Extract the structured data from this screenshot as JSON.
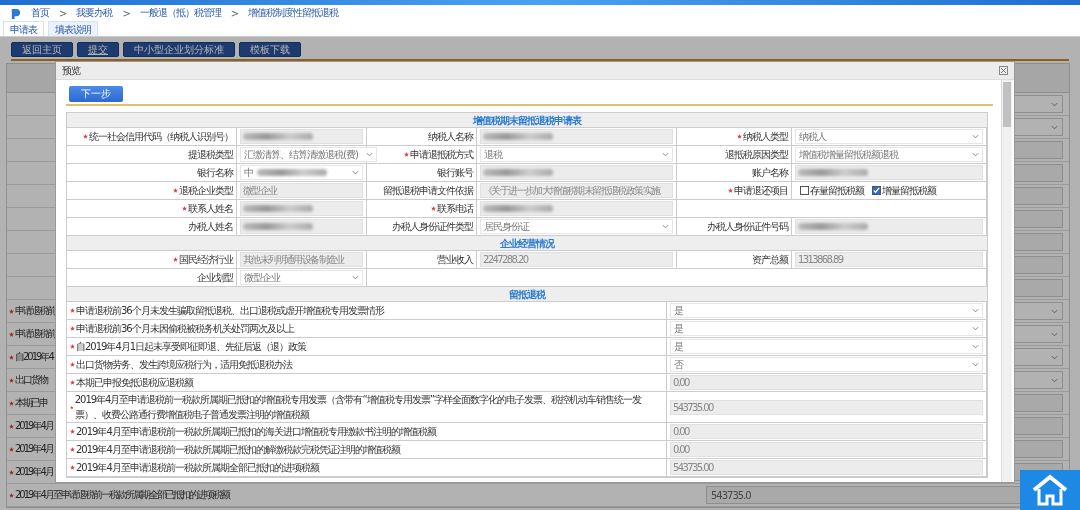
{
  "breadcrumb": {
    "separator": ">",
    "items": [
      "首页",
      "我要办税",
      "一般退（抵）税管理",
      "增值税制度性留抵退税"
    ]
  },
  "tabs": [
    {
      "label": "申请表",
      "selected": true
    },
    {
      "label": "填表说明",
      "selected": false
    }
  ],
  "toolbar": [
    {
      "label": "返回主页",
      "underlined": false
    },
    {
      "label": "提交",
      "underlined": true
    },
    {
      "label": "中小型企业划分标准",
      "underlined": false
    },
    {
      "label": "模板下载",
      "underlined": false
    }
  ],
  "background": {
    "rows": [
      {
        "kind": "select"
      },
      {
        "kind": "select"
      },
      {
        "kind": "input"
      },
      {
        "kind": "input"
      },
      {
        "kind": "input"
      },
      {
        "kind": "input"
      },
      {
        "kind": "input"
      },
      {
        "kind": "input"
      },
      {
        "kind": "input"
      },
      {
        "label": "申请退税前",
        "required": true,
        "kind": "select"
      },
      {
        "label": "申请退税前",
        "required": true,
        "kind": "select"
      },
      {
        "label": "自2019年4",
        "required": true,
        "kind": "select"
      },
      {
        "label": "出口货物",
        "required": true,
        "kind": "select"
      },
      {
        "label": "本期已申",
        "required": true,
        "kind": "input"
      },
      {
        "label": "2019年4月",
        "required": true,
        "kind": "input"
      },
      {
        "label": "2019年4月",
        "required": true,
        "kind": "input"
      },
      {
        "label": "2019年4月",
        "required": true,
        "kind": "input"
      },
      {
        "label": "2019年4月至申请退税前一税款所属期全部已抵扣的进项税额",
        "required": true,
        "kind": "input",
        "value": "543735.0"
      }
    ]
  },
  "dialog": {
    "title": "预览",
    "next_button": "下一步",
    "sections": [
      {
        "title": "增值税期末留抵退税申请表",
        "kind": "grid",
        "rows": [
          [
            {
              "label": "统一社会信用代码（纳税人识别号）",
              "required": true,
              "kind": "text",
              "redacted": true
            },
            {
              "label": "纳税人名称",
              "required": false,
              "kind": "text",
              "redacted": true
            },
            {
              "label": "纳税人类型",
              "required": true,
              "kind": "select",
              "value": "纳税人"
            }
          ],
          [
            {
              "label": "提退税类型",
              "required": false,
              "kind": "select",
              "value": "汇缴清算、结算清缴退税(费)"
            },
            {
              "label": "申请退抵税方式",
              "required": true,
              "kind": "select",
              "value": "退税"
            },
            {
              "label": "退抵税原因类型",
              "required": false,
              "kind": "select",
              "value": "增值税增量留抵税额退税"
            }
          ],
          [
            {
              "label": "银行名称",
              "required": false,
              "kind": "select",
              "value": "中",
              "redacted": true
            },
            {
              "label": "银行账号",
              "required": false,
              "kind": "text",
              "redacted": true
            },
            {
              "label": "账户名称",
              "required": false,
              "kind": "text",
              "redacted": true
            }
          ],
          [
            {
              "label": "退税企业类型",
              "required": true,
              "kind": "text",
              "value": "微型企业"
            },
            {
              "label": "留抵退税申请文件依据",
              "required": false,
              "kind": "text",
              "value": "《关于进一步加大增值税期末留抵退税政策实施"
            },
            {
              "label": "申请退还项目",
              "required": true,
              "kind": "checks",
              "options": [
                {
                  "label": "存量留抵税额",
                  "checked": false
                },
                {
                  "label": "增量留抵税额",
                  "checked": true
                }
              ]
            }
          ],
          [
            {
              "label": "联系人姓名",
              "required": true,
              "kind": "text",
              "redacted": true
            },
            {
              "label": "联系电话",
              "required": true,
              "kind": "text",
              "redacted": true
            },
            {
              "kind": "blank"
            }
          ],
          [
            {
              "label": "办税人姓名",
              "required": false,
              "kind": "text",
              "redacted": true
            },
            {
              "label": "办税人身份证件类型",
              "required": false,
              "kind": "select",
              "value": "居民身份证"
            },
            {
              "label": "办税人身份证件号码",
              "required": false,
              "kind": "text",
              "redacted": true
            }
          ]
        ]
      },
      {
        "title": "企业经营情况",
        "kind": "grid",
        "rows": [
          [
            {
              "label": "国民经济行业",
              "required": true,
              "kind": "text",
              "value": "其他未列明通用设备制造业"
            },
            {
              "label": "营业收入",
              "required": false,
              "kind": "text",
              "value": "2247288.20"
            },
            {
              "label": "资产总额",
              "required": false,
              "kind": "text",
              "value": "1313868.89"
            }
          ],
          [
            {
              "label": "企业划型",
              "required": false,
              "kind": "select",
              "value": "微型企业"
            },
            {
              "kind": "blank"
            }
          ]
        ]
      },
      {
        "title": "留抵退税",
        "kind": "list",
        "rows": [
          {
            "label": "申请退税前36个月未发生骗取留抵退税、出口退税或虚开增值税专用发票情形",
            "required": true,
            "kind": "select",
            "value": "是"
          },
          {
            "label": "申请退税前36个月未因偷税被税务机关处罚两次及以上",
            "required": true,
            "kind": "select",
            "value": "是"
          },
          {
            "label": "自2019年4月1日起未享受即征即退、先征后返（退）政策",
            "required": true,
            "kind": "select",
            "value": "是"
          },
          {
            "label": "出口货物劳务、发生跨境应税行为，适用免抵退税办法",
            "required": true,
            "kind": "select",
            "value": "否"
          },
          {
            "label": "本期已申报免抵退税应退税额",
            "required": true,
            "kind": "text",
            "value": "0.00"
          },
          {
            "label": "2019年4月至申请退税前一税款所属期已抵扣的增值税专用发票（含带有“增值税专用发票”字样全面数字化的电子发票、税控机动车销售统一发票）、收费公路通行费增值税电子普通发票注明的增值税额",
            "required": true,
            "kind": "text",
            "value": "543735.00"
          },
          {
            "label": "2019年4月至申请退税前一税款所属期已抵扣的海关进口增值税专用缴款书注明的增值税额",
            "required": true,
            "kind": "text",
            "value": "0.00"
          },
          {
            "label": "2019年4月至申请退税前一税款所属期已抵扣的解缴税款完税凭证注明的增值税额",
            "required": true,
            "kind": "text",
            "value": "0.00"
          },
          {
            "label": "2019年4月至申请退税前一税款所属期全部已抵扣的进项税额",
            "required": true,
            "kind": "text",
            "value": "543735.00"
          }
        ]
      }
    ]
  }
}
